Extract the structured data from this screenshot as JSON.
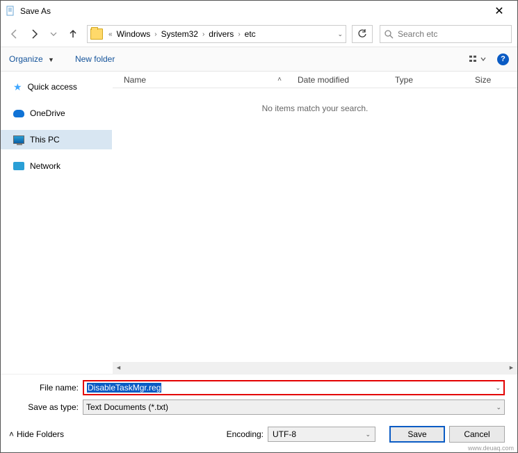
{
  "title": "Save As",
  "breadcrumb": {
    "prefix": "«",
    "parts": [
      "Windows",
      "System32",
      "drivers",
      "etc"
    ]
  },
  "search": {
    "placeholder": "Search etc"
  },
  "toolbar": {
    "organize": "Organize",
    "new_folder": "New folder"
  },
  "sidebar": {
    "items": [
      {
        "label": "Quick access"
      },
      {
        "label": "OneDrive"
      },
      {
        "label": "This PC",
        "selected": true
      },
      {
        "label": "Network"
      }
    ]
  },
  "columns": {
    "name": "Name",
    "date": "Date modified",
    "type": "Type",
    "size": "Size"
  },
  "content": {
    "empty_message": "No items match your search."
  },
  "file_name": {
    "label": "File name:",
    "value": "DisableTaskMgr.reg"
  },
  "save_type": {
    "label": "Save as type:",
    "value": "Text Documents (*.txt)"
  },
  "encoding": {
    "label": "Encoding:",
    "value": "UTF-8"
  },
  "buttons": {
    "save": "Save",
    "cancel": "Cancel",
    "hide_folders": "Hide Folders"
  },
  "watermark": "www.deuaq.com"
}
